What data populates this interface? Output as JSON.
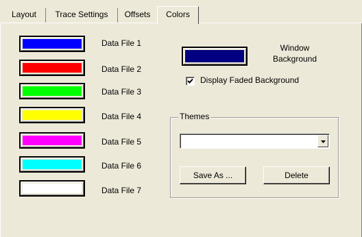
{
  "tabs": [
    {
      "label": "Layout"
    },
    {
      "label": "Trace Settings"
    },
    {
      "label": "Offsets"
    },
    {
      "label": "Colors",
      "active": true
    }
  ],
  "data_files": [
    {
      "label": "Data File 1",
      "color": "#0000FF"
    },
    {
      "label": "Data File 2",
      "color": "#FF0000"
    },
    {
      "label": "Data File 3",
      "color": "#00FF00"
    },
    {
      "label": "Data File 4",
      "color": "#FFFF00"
    },
    {
      "label": "Data File 5",
      "color": "#FF00FF"
    },
    {
      "label": "Data File 6",
      "color": "#00FFFF"
    },
    {
      "label": "Data File 7",
      "color": "#FFFFFF"
    }
  ],
  "window_background": {
    "label_line1": "Window",
    "label_line2": "Background",
    "color": "#000080"
  },
  "display_faded": {
    "label": "Display Faded Background",
    "checked": true
  },
  "themes": {
    "title": "Themes",
    "selected_value": "",
    "save_as_label": "Save As ...",
    "delete_label": "Delete"
  }
}
